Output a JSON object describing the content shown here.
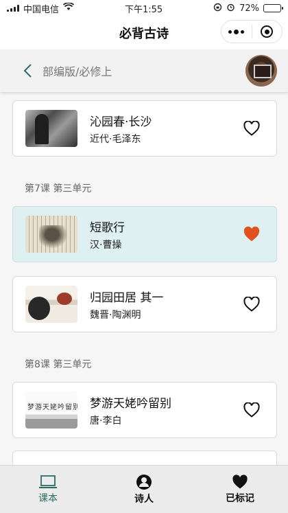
{
  "status_bar": {
    "carrier": "中国电信",
    "time": "下午1:55",
    "battery": "72%",
    "battery_level": 0.72
  },
  "nav": {
    "title": "必背古诗"
  },
  "sub_header": {
    "title": "部编版/必修上"
  },
  "sections": [
    {
      "heading": "第7课 第三单元"
    },
    {
      "heading": "第8课 第三单元"
    }
  ],
  "poems": [
    {
      "title": "沁园春·长沙",
      "author": "近代·毛泽东",
      "favorited": false,
      "thumb": "photo"
    },
    {
      "title": "短歌行",
      "author": "汉·曹操",
      "favorited": true,
      "thumb": "calligraphy-painting"
    },
    {
      "title": "归园田居 其一",
      "author": "魏晋·陶渊明",
      "favorited": false,
      "thumb": "ink-painting"
    },
    {
      "title": "梦游天姥吟留别",
      "author": "唐·李白",
      "favorited": false,
      "thumb": "calligraphy",
      "thumb_text": "梦游天姥吟留别"
    }
  ],
  "tabs": [
    {
      "label": "课本",
      "icon": "laptop-icon",
      "active": true
    },
    {
      "label": "诗人",
      "icon": "person-icon",
      "active": false
    },
    {
      "label": "已标记",
      "icon": "heart-icon",
      "active": false
    }
  ],
  "colors": {
    "accent": "#2b6e62",
    "favorite": "#e0521f",
    "active_card": "#dff0f0"
  }
}
